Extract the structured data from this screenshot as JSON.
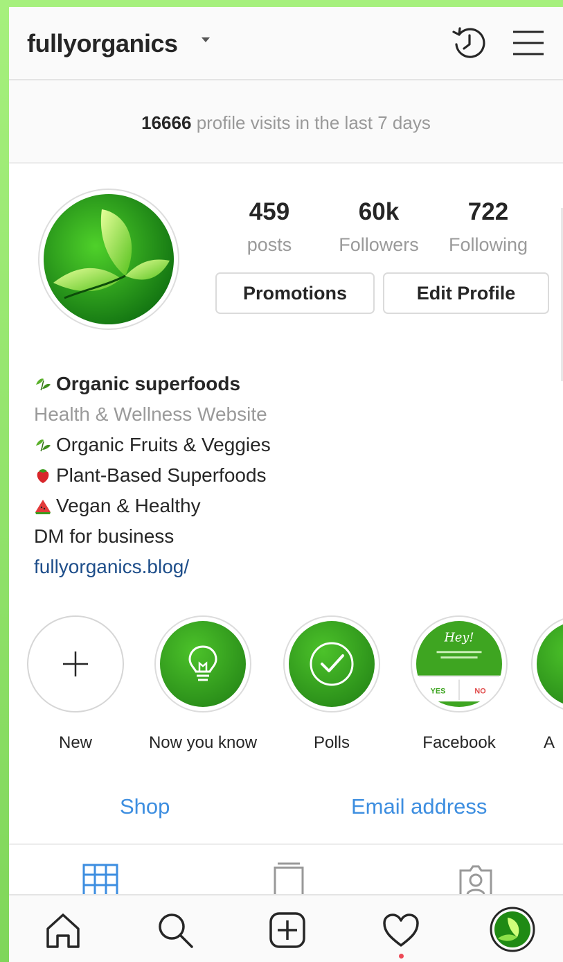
{
  "header": {
    "username": "fullyorganics",
    "icons": [
      "activity-history-icon",
      "menu-icon"
    ]
  },
  "visits": {
    "count": "16666",
    "text": "profile visits in the last 7 days"
  },
  "stats": [
    {
      "value": "459",
      "label": "posts"
    },
    {
      "value": "60k",
      "label": "Followers"
    },
    {
      "value": "722",
      "label": "Following"
    }
  ],
  "buttons": {
    "promotions": "Promotions",
    "edit_profile": "Edit Profile"
  },
  "bio": {
    "name": "Organic superfoods",
    "category": "Health & Wellness Website",
    "lines": [
      "Organic Fruits & Veggies",
      "Plant-Based Superfoods",
      "Vegan & Healthy",
      "DM for business"
    ],
    "link": "fullyorganics.blog/"
  },
  "highlights": [
    {
      "label": "New"
    },
    {
      "label": "Now you know"
    },
    {
      "label": "Polls"
    },
    {
      "label": "Facebook"
    },
    {
      "label": "A"
    }
  ],
  "facebook_highlight": {
    "heading": "Hey!",
    "yes": "YES",
    "no": "NO"
  },
  "actions": {
    "shop": "Shop",
    "email": "Email address"
  },
  "tabs": [
    "grid-icon",
    "igtv-icon",
    "tagged-icon"
  ],
  "nav": [
    "home-icon",
    "search-icon",
    "new-post-icon",
    "activity-heart-icon",
    "profile-avatar"
  ],
  "colors": {
    "brand_green": "#2f9a1c",
    "link_blue": "#1e4e8a",
    "action_blue": "#3d8ee0",
    "notification_red": "#ed4956"
  }
}
